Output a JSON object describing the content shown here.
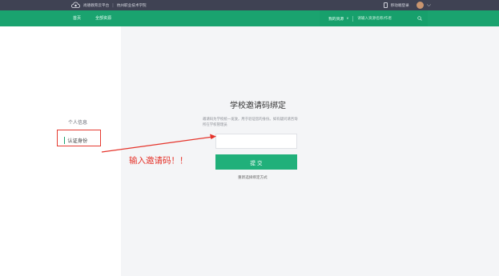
{
  "topbar": {
    "brand": "尚德教育云平台",
    "school": "杭州职业技术学院",
    "mobile_link": "移动端登录",
    "chevron": "⌵"
  },
  "nav": {
    "home": "首页",
    "all_resources": "全部资源"
  },
  "search": {
    "scope": "我的资源",
    "caret": "∨",
    "placeholder": "请输入资源名称/作者",
    "icon": "search-icon"
  },
  "sidebar": {
    "items": [
      {
        "label": "个人信息"
      },
      {
        "label": "认证身份"
      }
    ]
  },
  "main": {
    "title": "学校邀请码绑定",
    "description": "邀请码为学校统一发放，用于验证您的身份。如有疑问请咨询所在学校管理员",
    "input_value": "",
    "submit_label": "提 交",
    "alt_link": "重新选择绑定方式"
  },
  "annotation": {
    "text": "输入邀请码！！"
  },
  "colors": {
    "topbar": "#3f4253",
    "brand_green": "#1aa36f",
    "button_green": "#20b07a",
    "annotation_red": "#e5332a",
    "main_bg": "#f4f5f7"
  }
}
